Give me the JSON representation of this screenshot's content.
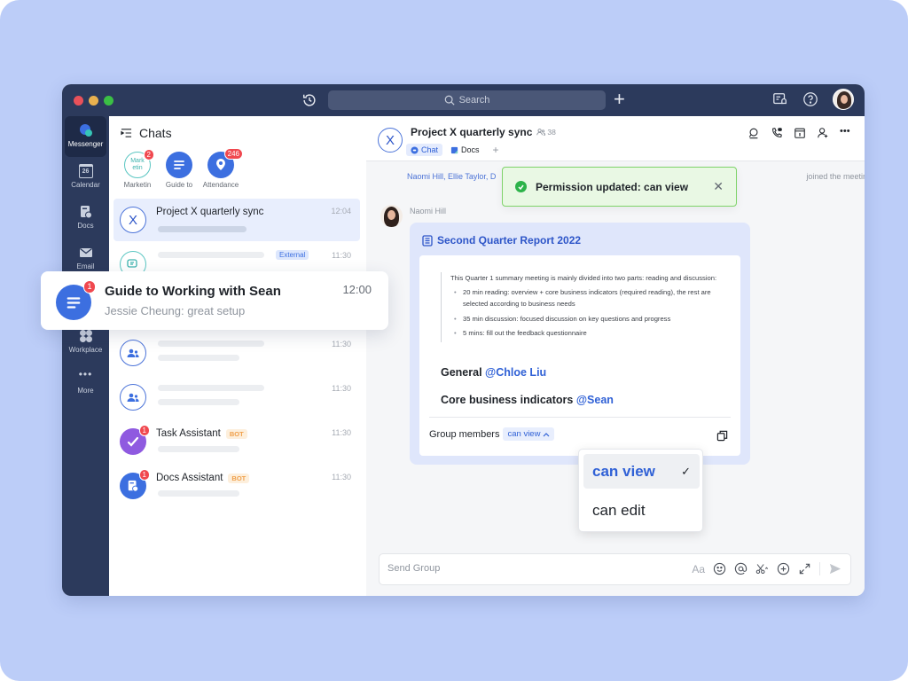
{
  "window": {
    "search_placeholder": "Search"
  },
  "nav": {
    "items": [
      {
        "label": "Messenger",
        "icon": "messenger-icon",
        "active": true
      },
      {
        "label": "Calendar",
        "icon": "calendar-icon",
        "date": "26"
      },
      {
        "label": "Docs",
        "icon": "docs-icon"
      },
      {
        "label": "Email",
        "icon": "email-icon"
      },
      {
        "label": "Workplace",
        "icon": "workplace-icon"
      },
      {
        "label": "More",
        "icon": "more-icon"
      }
    ]
  },
  "chatlist": {
    "title": "Chats",
    "pinned": [
      {
        "label": "Marketin",
        "avatar_text": "Mark etin",
        "badge": "2"
      },
      {
        "label": "Guide to",
        "badge": ""
      },
      {
        "label": "Attendance",
        "badge": "246"
      }
    ],
    "rows": [
      {
        "name": "Project X quarterly sync",
        "time": "12:04",
        "avatar_text": "X"
      },
      {
        "name": "",
        "time": "11:30",
        "tag": "External"
      },
      {
        "name": "",
        "time": "11:30"
      },
      {
        "name": "",
        "time": "11:30"
      },
      {
        "name": "Task Assistant",
        "time": "11:30",
        "tag": "BOT",
        "badge": "1"
      },
      {
        "name": "Docs Assistant",
        "time": "11:30",
        "tag": "BOT",
        "badge": "1"
      }
    ]
  },
  "notification": {
    "title": "Guide to Working with Sean",
    "subtitle": "Jessie Cheung: great setup",
    "time": "12:00",
    "badge": "1"
  },
  "chat": {
    "avatar_text": "X",
    "title": "Project X quarterly sync",
    "member_count": "38",
    "tabs": [
      {
        "label": "Chat",
        "active": true
      },
      {
        "label": "Docs",
        "active": false
      }
    ],
    "tab_add": "+",
    "joined_names": "Naomi Hill,  Ellie Taylor,  D",
    "joined_suffix": "joined the meeting",
    "toast": {
      "text": "Permission updated: can view",
      "close": "✕"
    },
    "message": {
      "sender": "Naomi Hill",
      "doc_title": "Second Quarter Report 2022",
      "intro": "This Quarter 1 summary meeting is mainly divided into two parts: reading and discussion:",
      "bullets": [
        "20 min reading: overview + core business indicators (required reading), the rest are selected according to business needs",
        "35 min discussion: focused discussion on key questions and progress",
        "5 mins: fill out the feedback questionnaire"
      ],
      "assignments": [
        {
          "label": "General",
          "mention": "@Chloe Liu"
        },
        {
          "label": "Core business indicators",
          "mention": "@Sean"
        }
      ],
      "permission_label": "Group members",
      "permission_value": "can view"
    },
    "dropdown": {
      "options": [
        {
          "label": "can view",
          "selected": true
        },
        {
          "label": "can edit",
          "selected": false
        }
      ],
      "check": "✓"
    },
    "composer": {
      "placeholder": "Send Group",
      "font_label": "Aa"
    }
  },
  "colors": {
    "accent": "#3061d6",
    "titlebar": "#2c3a5c",
    "toast_bg": "#e9f8e4",
    "toast_border": "#7fd36a",
    "badge": "#f0484f",
    "bot_tag": "#f0a04b"
  }
}
